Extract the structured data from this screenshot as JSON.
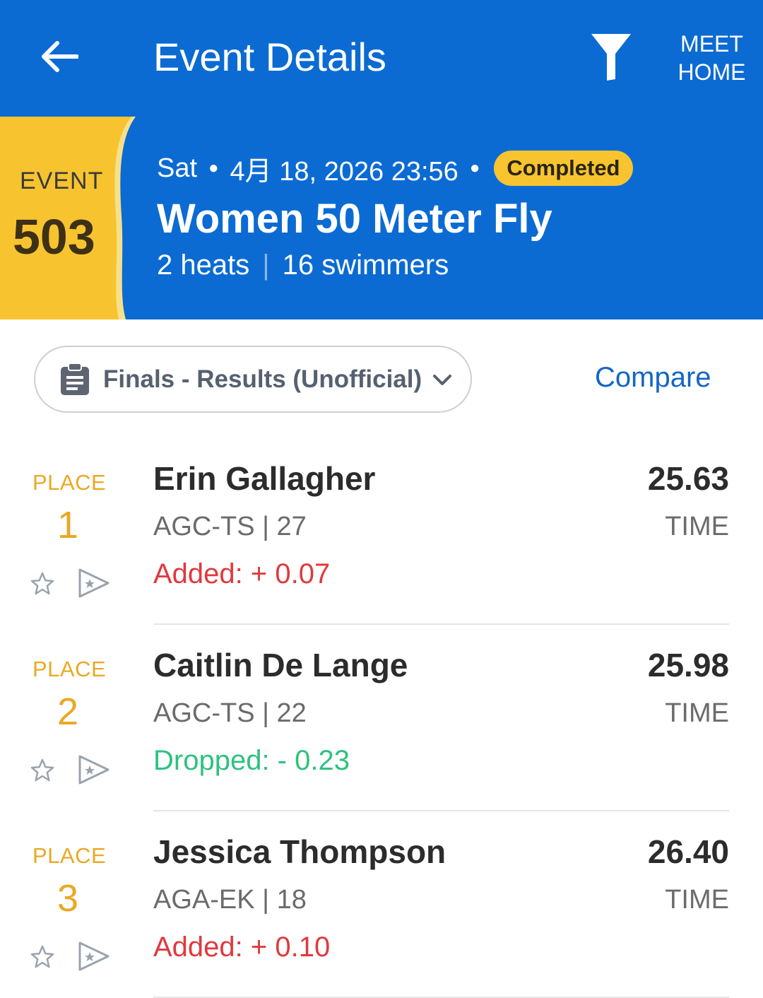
{
  "appbar": {
    "title": "Event Details",
    "meet_home_line1": "MEET",
    "meet_home_line2": "HOME",
    "back_icon": "arrow-left-icon",
    "filter_icon": "filter-icon"
  },
  "event": {
    "tag_label": "EVENT",
    "number": "503",
    "day": "Sat",
    "datetime": "4月 18, 2026 23:56",
    "status": "Completed",
    "name": "Women 50 Meter Fly",
    "heats": "2 heats",
    "swimmers": "16 swimmers"
  },
  "results_selector": {
    "label": "Finals - Results (Unofficial)",
    "icon": "clipboard-icon"
  },
  "compare_label": "Compare",
  "colors": {
    "primary": "#0b6bd3",
    "accent": "#f7c430",
    "place": "#e9a925",
    "added": "#e0393e",
    "dropped": "#2ec27e"
  },
  "results": [
    {
      "place_label": "PLACE",
      "place": "1",
      "name": "Erin Gallagher",
      "team_age": "AGC-TS | 27",
      "delta": "Added: + 0.07",
      "delta_type": "added",
      "time": "25.63",
      "time_label": "TIME"
    },
    {
      "place_label": "PLACE",
      "place": "2",
      "name": "Caitlin De Lange",
      "team_age": "AGC-TS | 22",
      "delta": "Dropped: - 0.23",
      "delta_type": "dropped",
      "time": "25.98",
      "time_label": "TIME"
    },
    {
      "place_label": "PLACE",
      "place": "3",
      "name": "Jessica Thompson",
      "team_age": "AGA-EK | 18",
      "delta": "Added: + 0.10",
      "delta_type": "added",
      "time": "26.40",
      "time_label": "TIME"
    }
  ]
}
